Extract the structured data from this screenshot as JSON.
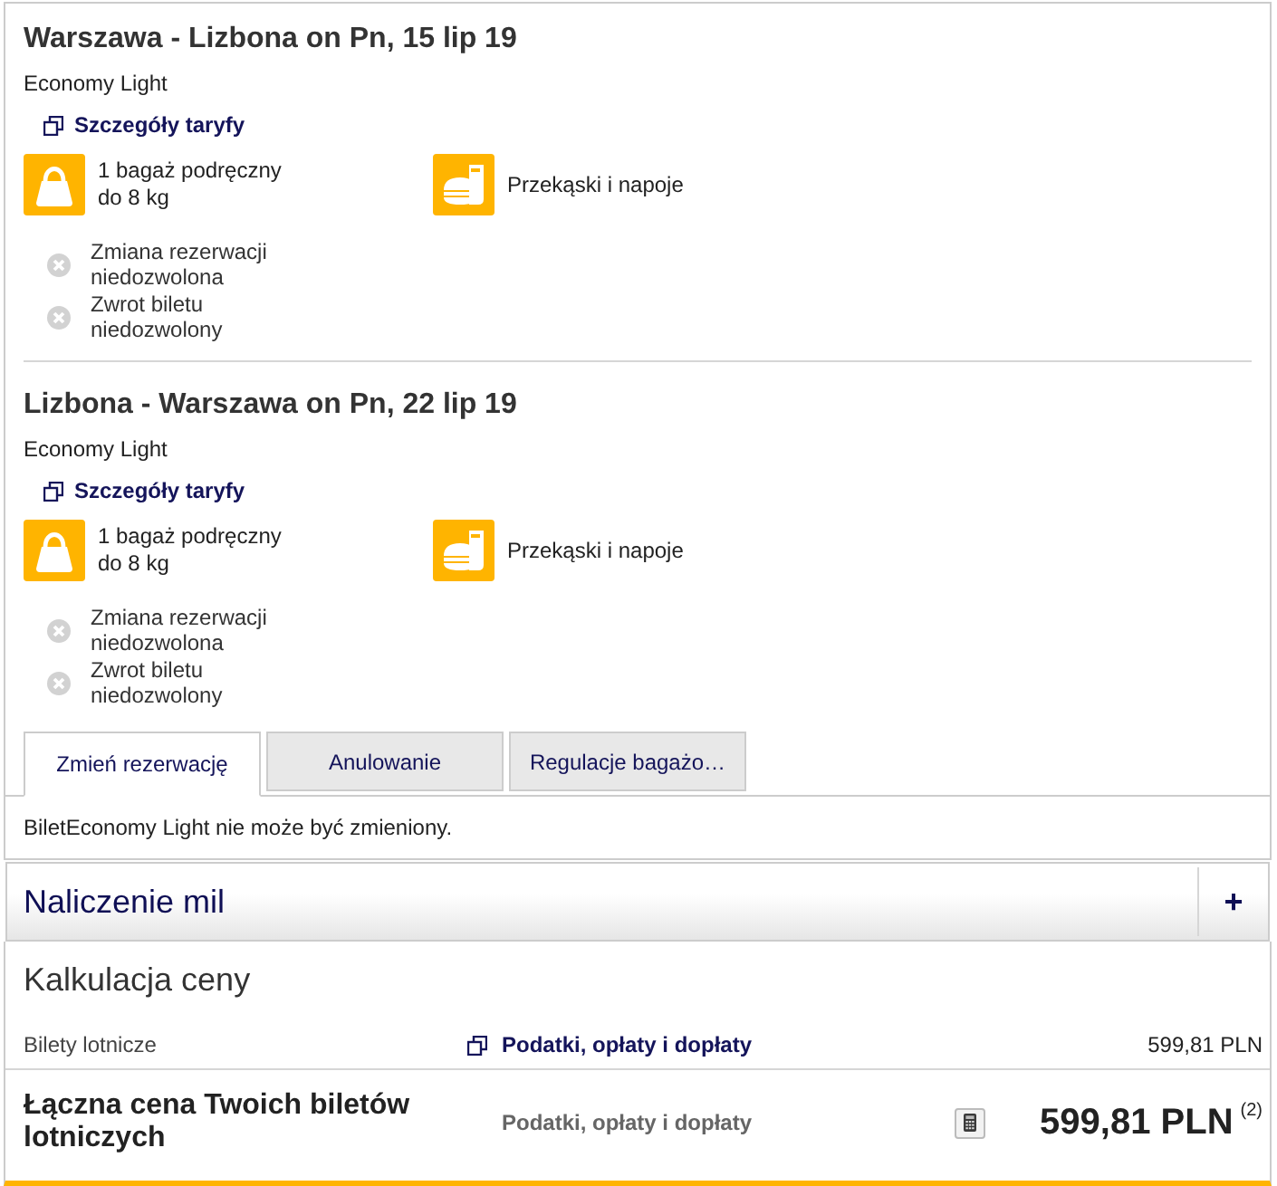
{
  "segments": [
    {
      "title": "Warszawa - Lizbona on Pn, 15 lip 19",
      "fare": "Economy Light",
      "details_link": "Szczegóły taryfy",
      "amenities": [
        {
          "kind": "baggage",
          "lines": [
            "1 bagaż podręczny",
            "do 8 kg"
          ]
        },
        {
          "kind": "snacks",
          "lines": [
            "Przekąski i napoje"
          ]
        }
      ],
      "restrictions": [
        {
          "allowed": false,
          "lines": [
            "Zmiana rezerwacji",
            "niedozwolona"
          ]
        },
        {
          "allowed": false,
          "lines": [
            "Zwrot biletu",
            "niedozwolony"
          ]
        }
      ]
    },
    {
      "title": "Lizbona - Warszawa on Pn, 22 lip 19",
      "fare": "Economy Light",
      "details_link": "Szczegóły taryfy",
      "amenities": [
        {
          "kind": "baggage",
          "lines": [
            "1 bagaż podręczny",
            "do 8 kg"
          ]
        },
        {
          "kind": "snacks",
          "lines": [
            "Przekąski i napoje"
          ]
        }
      ],
      "restrictions": [
        {
          "allowed": false,
          "lines": [
            "Zmiana rezerwacji",
            "niedozwolona"
          ]
        },
        {
          "allowed": false,
          "lines": [
            "Zwrot biletu",
            "niedozwolony"
          ]
        }
      ]
    }
  ],
  "tabs": [
    {
      "label": "Zmień rezerwację",
      "selected": true
    },
    {
      "label": "Anulowanie",
      "selected": false
    },
    {
      "label": "Regulacje bagażo…",
      "selected": false
    }
  ],
  "tab_content": "BiletEconomy Light nie może być zmieniony.",
  "miles": {
    "title": "Naliczenie mil",
    "toggle": "+"
  },
  "price": {
    "title": "Kalkulacja ceny",
    "rows": [
      {
        "kind": "item",
        "label": "Bilety lotnicze",
        "link": "Podatki, opłaty i dopłaty",
        "amount": "599,81 PLN"
      },
      {
        "kind": "total",
        "label": "Łączna cena Twoich biletów lotniczych",
        "link": "Podatki, opłaty i dopłaty",
        "amount": "599,81 PLN",
        "footnote": "(2)"
      }
    ]
  }
}
